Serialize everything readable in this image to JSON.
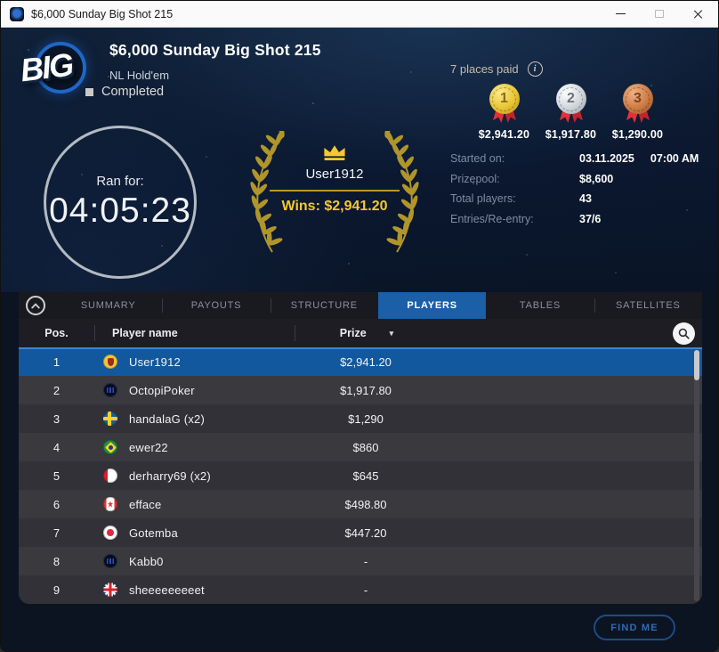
{
  "window": {
    "title": "$6,000 Sunday Big Shot 215"
  },
  "header": {
    "logo_text": "BIG",
    "title": "$6,000 Sunday Big Shot 215",
    "game_type": "NL Hold'em",
    "status": "Completed",
    "places_paid": "7 places paid",
    "medals": [
      {
        "rank": "1",
        "prize": "$2,941.20",
        "tone": "gold"
      },
      {
        "rank": "2",
        "prize": "$1,917.80",
        "tone": "silver"
      },
      {
        "rank": "3",
        "prize": "$1,290.00",
        "tone": "bronze"
      }
    ],
    "timer": {
      "label": "Ran for:",
      "value": "04:05:23"
    },
    "winner": {
      "name": "User1912",
      "wins": "Wins: $2,941.20"
    },
    "info": [
      {
        "label": "Started on:",
        "value": "03.11.2025",
        "value2": "07:00 AM"
      },
      {
        "label": "Prizepool:",
        "value": "$8,600",
        "value2": ""
      },
      {
        "label": "Total players:",
        "value": "43",
        "value2": ""
      },
      {
        "label": "Entries/Re-entry:",
        "value": "37/6",
        "value2": ""
      }
    ]
  },
  "tabs": [
    {
      "label": "SUMMARY",
      "active": false
    },
    {
      "label": "PAYOUTS",
      "active": false
    },
    {
      "label": "STRUCTURE",
      "active": false
    },
    {
      "label": "PLAYERS",
      "active": true
    },
    {
      "label": "TABLES",
      "active": false
    },
    {
      "label": "SATELLITES",
      "active": false
    }
  ],
  "players_table": {
    "columns": {
      "pos": "Pos.",
      "player": "Player name",
      "prize": "Prize"
    },
    "rows": [
      {
        "pos": "1",
        "flag": "ukraine-badge",
        "name": "User1912",
        "prize": "$2,941.20",
        "selected": true
      },
      {
        "pos": "2",
        "flag": "octopi-logo",
        "name": "OctopiPoker",
        "prize": "$1,917.80",
        "selected": false
      },
      {
        "pos": "3",
        "flag": "sweden",
        "name": "handalaG (x2)",
        "prize": "$1,290",
        "selected": false
      },
      {
        "pos": "4",
        "flag": "brazil",
        "name": "ewer22",
        "prize": "$860",
        "selected": false
      },
      {
        "pos": "5",
        "flag": "peru",
        "name": "derharry69 (x2)",
        "prize": "$645",
        "selected": false
      },
      {
        "pos": "6",
        "flag": "canada",
        "name": "efface",
        "prize": "$498.80",
        "selected": false
      },
      {
        "pos": "7",
        "flag": "japan",
        "name": "Gotemba",
        "prize": "$447.20",
        "selected": false
      },
      {
        "pos": "8",
        "flag": "octopi-logo",
        "name": "Kabb0",
        "prize": "-",
        "selected": false
      },
      {
        "pos": "9",
        "flag": "uk",
        "name": "sheeeeeeeeet",
        "prize": "-",
        "selected": false
      }
    ]
  },
  "footer": {
    "find_me": "FIND ME"
  },
  "icons": {
    "info": "i",
    "sort_caret": "▾"
  },
  "colors": {
    "accent_blue": "#1a5fa8",
    "gold": "#f4c832",
    "selected_row": "#11589e",
    "ribbon_red": "#d8232e"
  }
}
